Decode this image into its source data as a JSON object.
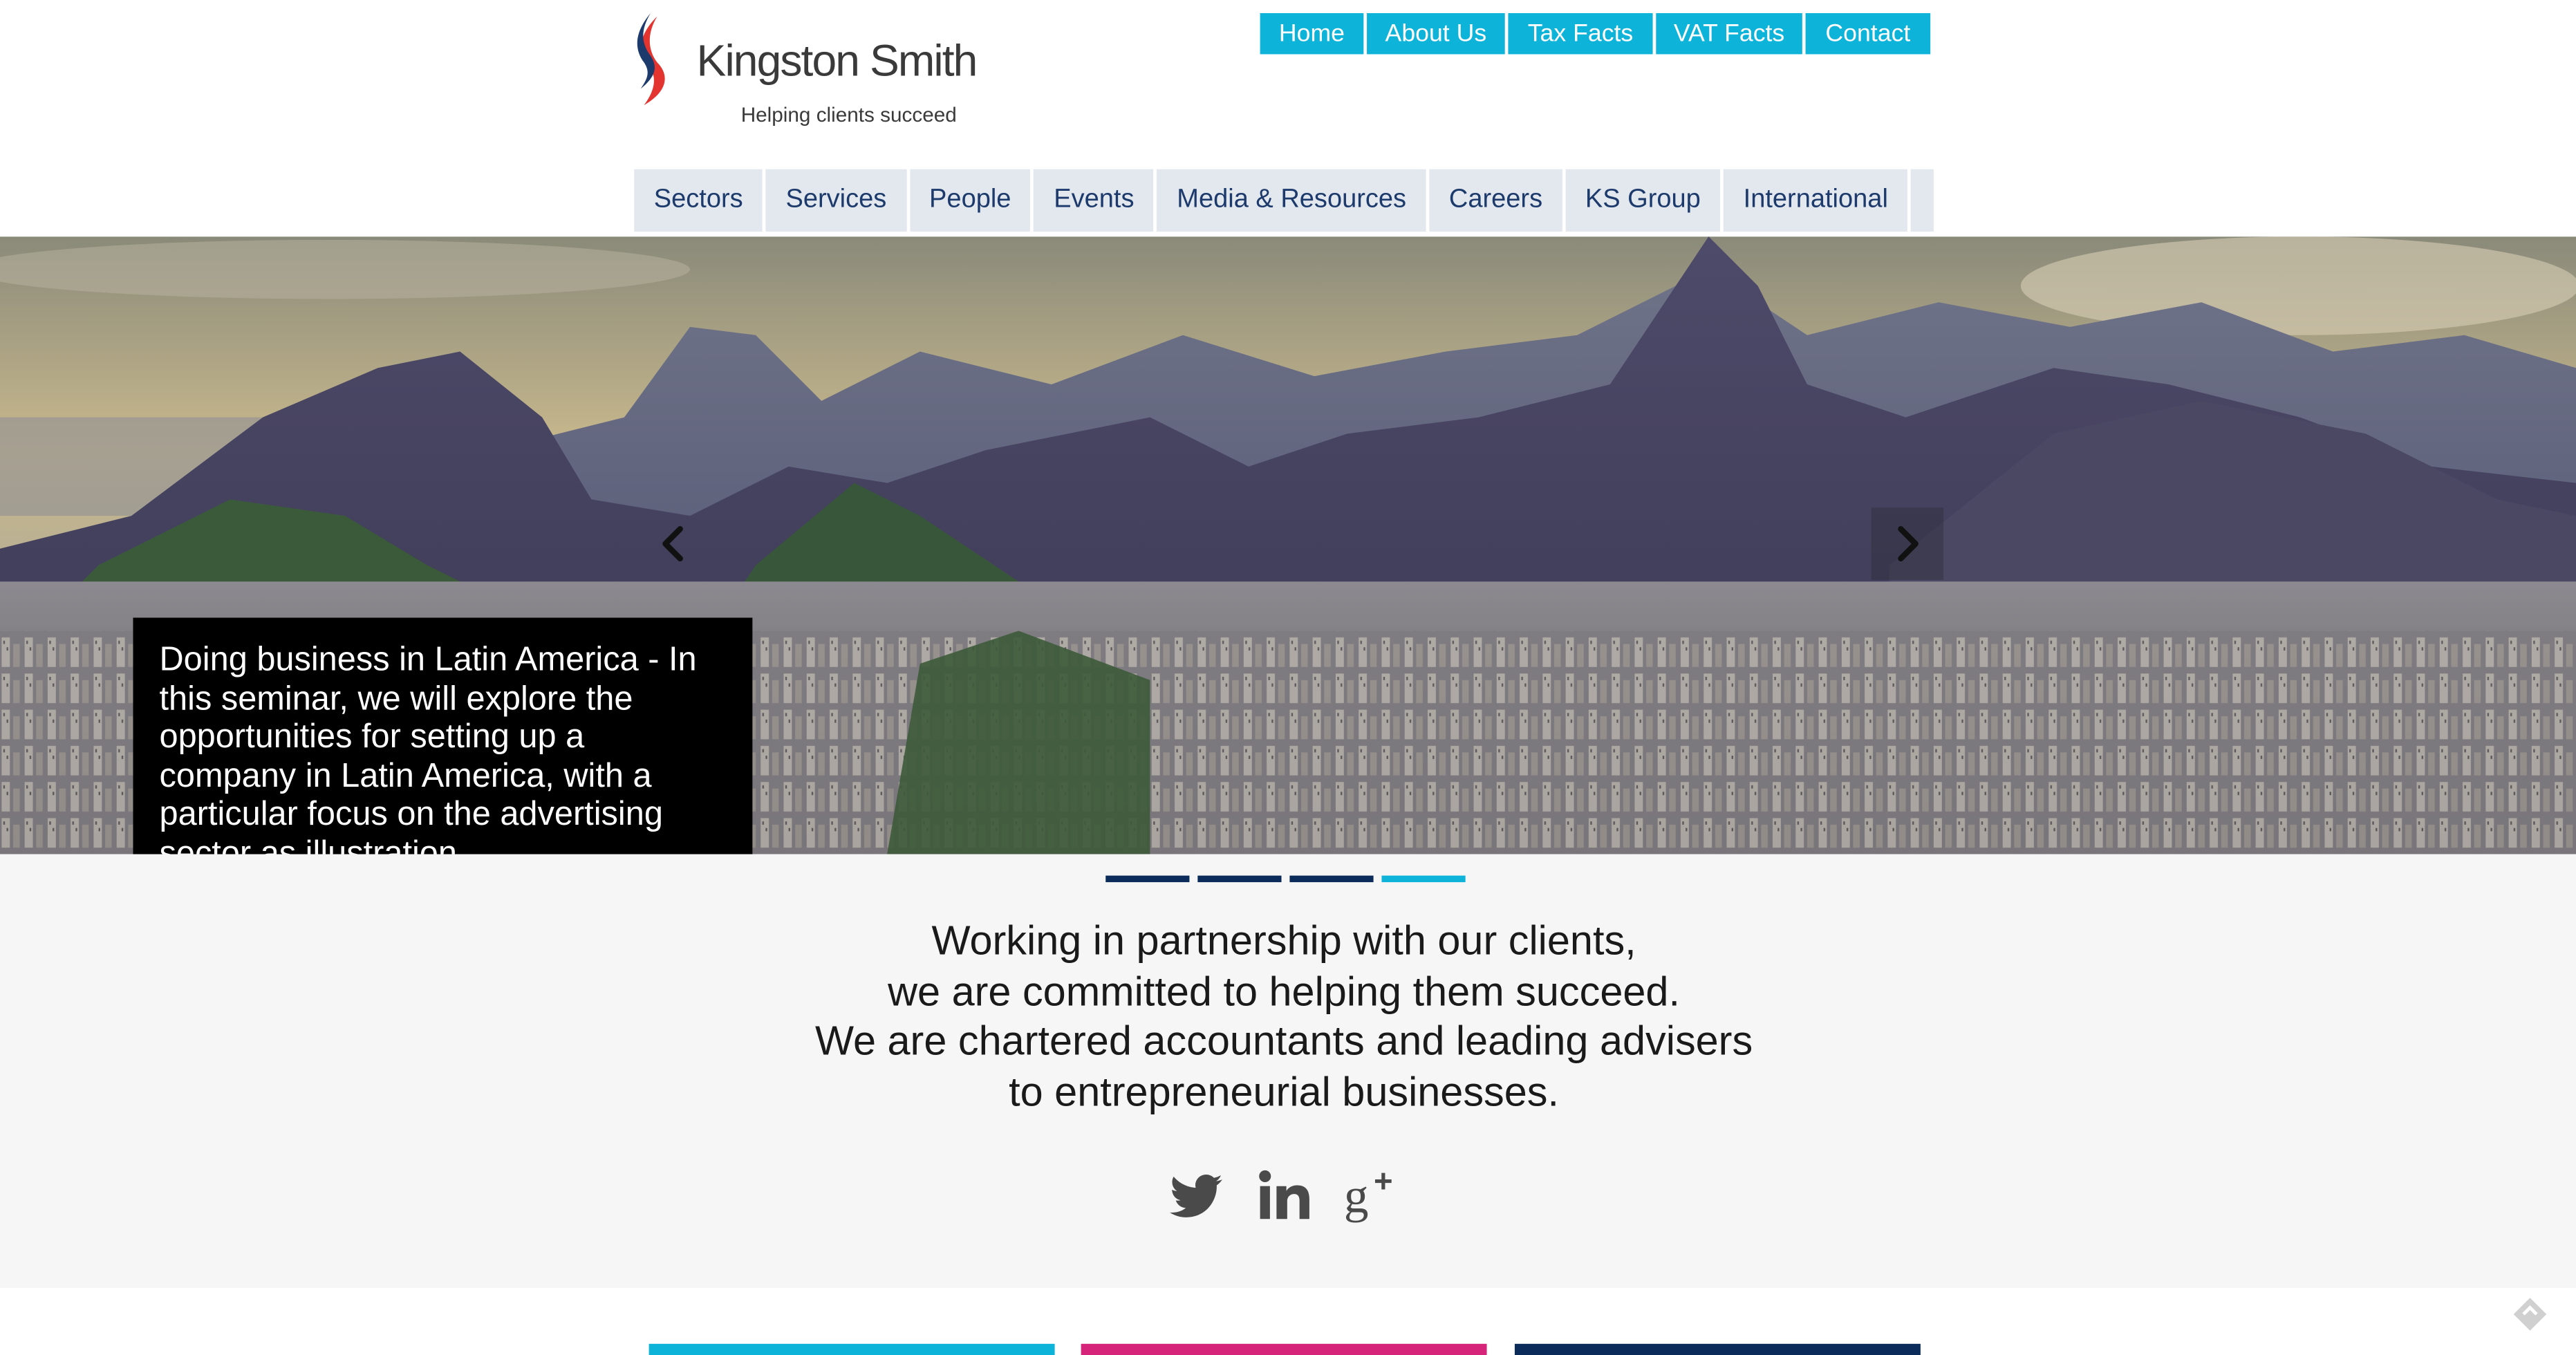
{
  "brand": {
    "name": "Kingston Smith",
    "tagline": "Helping clients succeed",
    "colors": {
      "red": "#e3342f",
      "blue": "#1c3a6b"
    }
  },
  "top_nav": [
    {
      "label": "Home"
    },
    {
      "label": "About Us"
    },
    {
      "label": "Tax Facts"
    },
    {
      "label": "VAT Facts"
    },
    {
      "label": "Contact"
    }
  ],
  "main_nav": [
    {
      "label": "Sectors"
    },
    {
      "label": "Services"
    },
    {
      "label": "People"
    },
    {
      "label": "Events"
    },
    {
      "label": "Media & Resources"
    },
    {
      "label": "Careers"
    },
    {
      "label": "KS Group"
    },
    {
      "label": "International"
    }
  ],
  "hero": {
    "caption": "Doing business in Latin America - In this seminar, we will explore the opportunities for setting up a company in Latin America, with a particular focus on the advertising sector as illustration",
    "prev_icon": "chevron-left",
    "next_icon": "chevron-right",
    "slides_total": 4,
    "active_slide": 4
  },
  "mission": {
    "line1": "Working in partnership with our clients,",
    "line2": "we are committed to helping them succeed.",
    "line3": "We are chartered accountants and leading advisers",
    "line4": "to entrepreneurial businesses."
  },
  "social": [
    {
      "icon": "twitter-icon"
    },
    {
      "icon": "linkedin-icon"
    },
    {
      "icon": "google-plus-icon"
    }
  ],
  "colors": {
    "accent": "#0db3d9",
    "nav_bg": "#e3e7ee",
    "nav_text": "#1c3a6b",
    "footer_bars": [
      "#0db3d9",
      "#d6247a",
      "#0b2b5a"
    ]
  }
}
